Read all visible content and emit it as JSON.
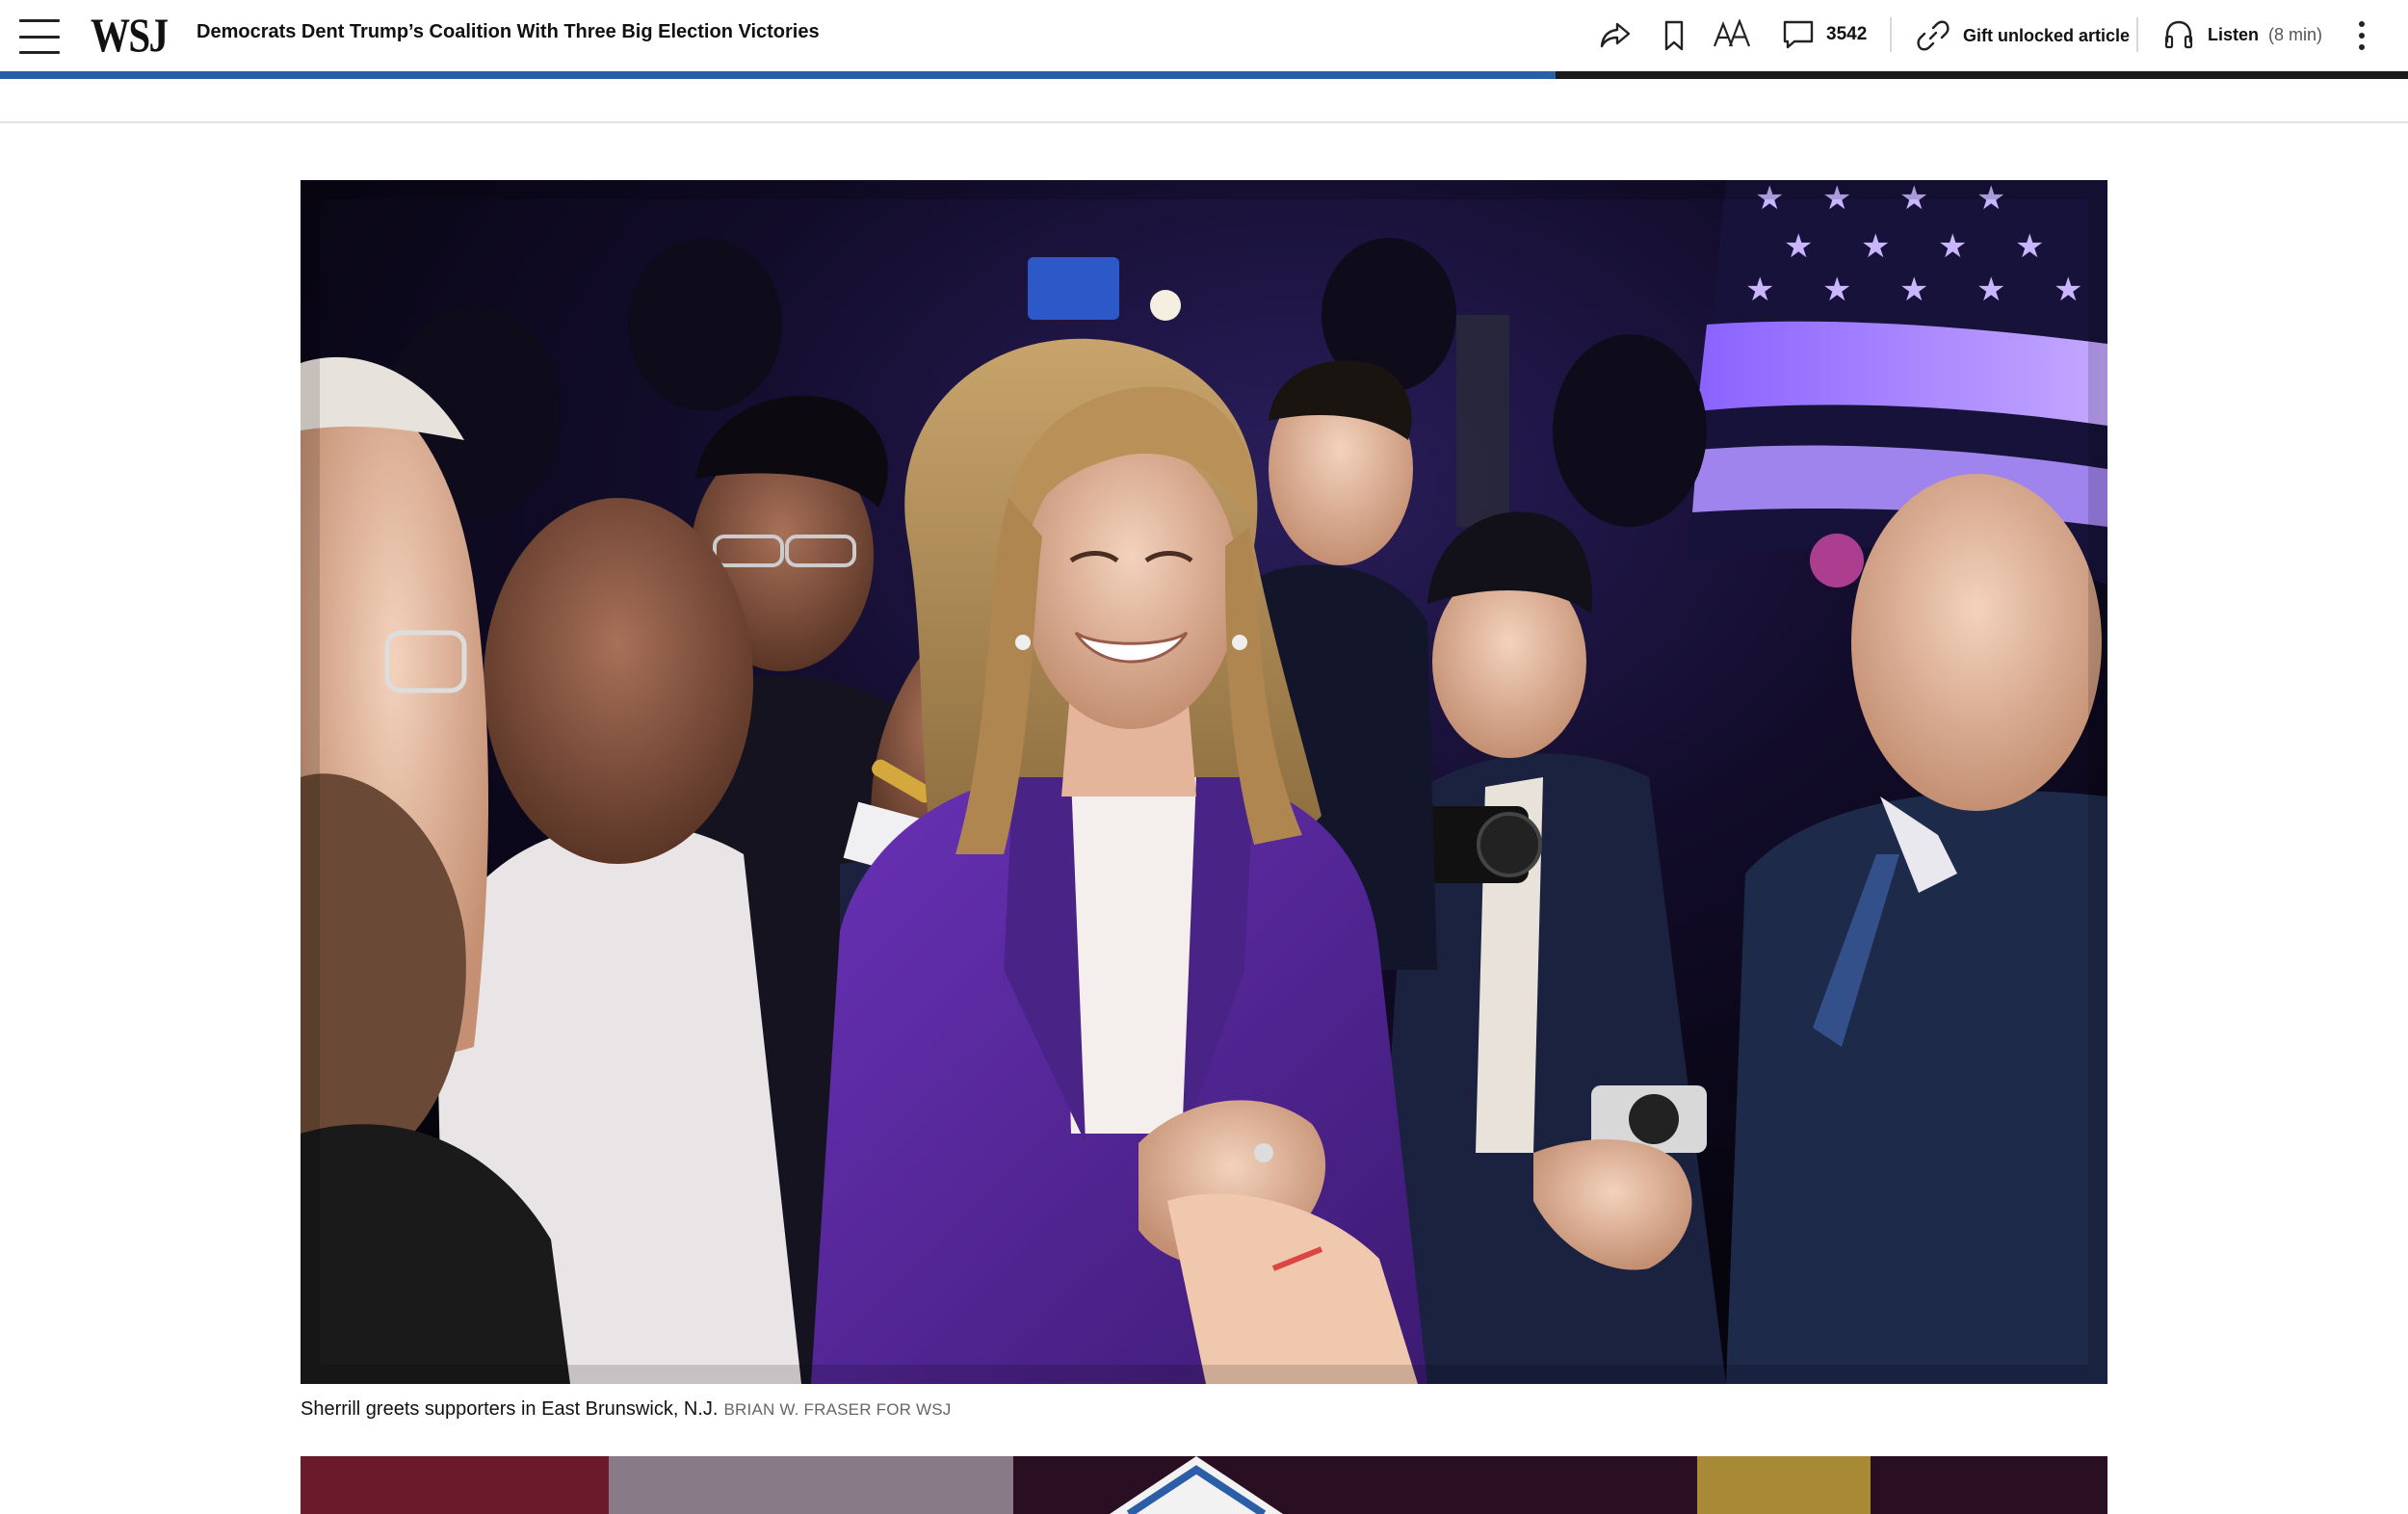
{
  "header": {
    "logo": "WSJ",
    "headline": "Democrats Dent Trump’s Coalition With Three Big Election Victories",
    "comment_count": "3542",
    "gift_label": "Gift unlocked article",
    "listen_label": "Listen",
    "listen_duration": "(8 min)",
    "reading_progress": 0.646
  },
  "figure": {
    "caption": "Sherrill greets supporters in East Brunswick, N.J.",
    "credit": "BRIAN W. FRASER FOR WSJ"
  },
  "colors": {
    "progress": "#2c5ea8",
    "jacket": "#5b2a9e",
    "stage_light": "#7c4dff"
  },
  "icons": [
    "menu-icon",
    "share-icon",
    "bookmark-icon",
    "text-size-icon",
    "comment-icon",
    "link-icon",
    "headphones-icon",
    "more-icon"
  ]
}
